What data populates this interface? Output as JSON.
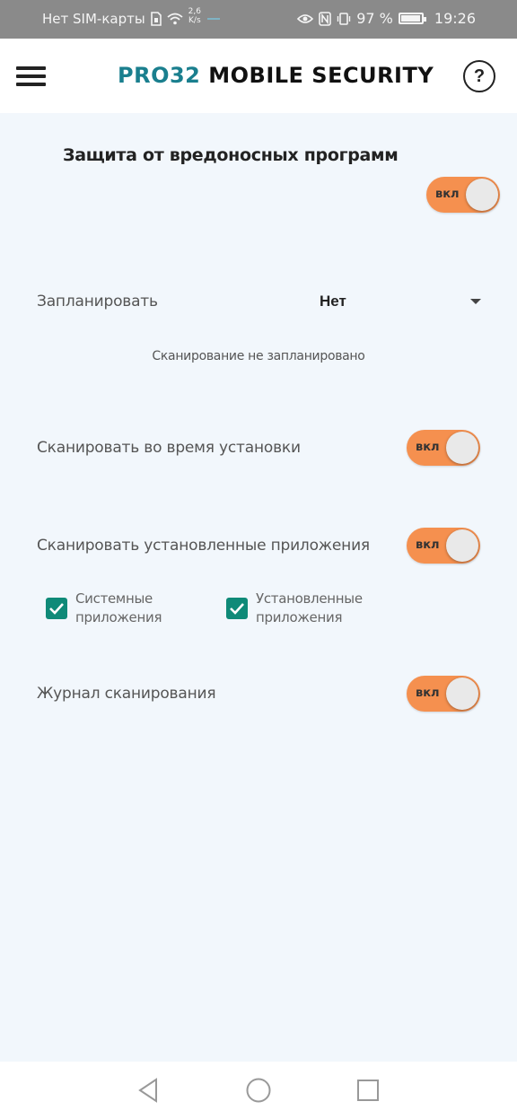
{
  "status_bar": {
    "carrier": "Нет SIM-карты",
    "net_speed_value": "2,6",
    "net_speed_unit": "K/s",
    "battery_percent": "97 %",
    "time": "19:26",
    "battery_level": 0.97
  },
  "header": {
    "logo_brand": "PRO32",
    "logo_rest": "MOBILE SECURITY",
    "help_label": "?"
  },
  "main": {
    "section_title": "Защита от вредоносных программ",
    "protection_toggle": {
      "label": "вкл",
      "on": true
    },
    "schedule": {
      "label": "Запланировать",
      "value": "Нет",
      "hint": "Сканирование не запланировано"
    },
    "scan_on_install": {
      "label": "Сканировать во время установки",
      "toggle_label": "вкл",
      "on": true
    },
    "scan_installed": {
      "label": "Сканировать установленные приложения",
      "toggle_label": "вкл",
      "on": true,
      "options": [
        {
          "line1": "Системные",
          "line2": "приложения",
          "checked": true
        },
        {
          "line1": "Установленные",
          "line2": "приложения",
          "checked": true
        }
      ]
    },
    "scan_log": {
      "label": "Журнал сканирования",
      "toggle_label": "вкл",
      "on": true
    }
  },
  "colors": {
    "accent_toggle": "#f5904f",
    "checkbox": "#0f8a78",
    "brand": "#1a7f8e",
    "background": "#f2f7fc"
  },
  "nav_bar": {
    "icons": [
      "back-icon",
      "home-icon",
      "recents-icon"
    ]
  }
}
